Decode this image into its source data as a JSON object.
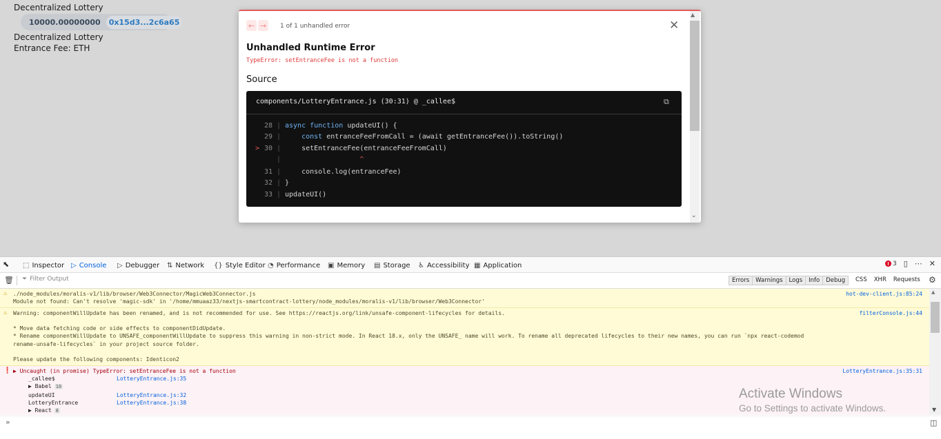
{
  "page": {
    "app_title": "Decentralized Lottery",
    "balance": "10000.00000000",
    "address": "0x15d3...2c6a65",
    "lottery_title": "Decentralized Lottery",
    "entrance_fee": "Entrance Fee: ETH"
  },
  "error_overlay": {
    "prev_arrow": "←",
    "next_arrow": "→",
    "count_text": "1 of 1 unhandled error",
    "close": "✕",
    "heading": "Unhandled Runtime Error",
    "message": "TypeError: setEntranceFee is not a function",
    "source_label": "Source",
    "file_location": "components/LotteryEntrance.js (30:31) @ _callee$",
    "code_lines": [
      {
        "marker": "",
        "num": "28",
        "code": "async function updateUI() {"
      },
      {
        "marker": "",
        "num": "29",
        "code": "    const entranceFeeFromCall = (await getEntranceFee()).toString()"
      },
      {
        "marker": ">",
        "num": "30",
        "code": "    setEntranceFee(entranceFeeFromCall)"
      },
      {
        "marker": "",
        "num": "",
        "code": "                  ^"
      },
      {
        "marker": "",
        "num": "31",
        "code": "    console.log(entranceFee)"
      },
      {
        "marker": "",
        "num": "32",
        "code": "}"
      },
      {
        "marker": "",
        "num": "33",
        "code": "updateUI()"
      }
    ]
  },
  "devtools": {
    "tabs": [
      {
        "name": "inspector",
        "label": "Inspector",
        "icon": "⬚"
      },
      {
        "name": "console",
        "label": "Console",
        "icon": "▷",
        "active": true
      },
      {
        "name": "debugger",
        "label": "Debugger",
        "icon": "▷"
      },
      {
        "name": "network",
        "label": "Network",
        "icon": "⇅"
      },
      {
        "name": "style-editor",
        "label": "Style Editor",
        "icon": "{}"
      },
      {
        "name": "performance",
        "label": "Performance",
        "icon": "◔"
      },
      {
        "name": "memory",
        "label": "Memory",
        "icon": "▣"
      },
      {
        "name": "storage",
        "label": "Storage",
        "icon": "▤"
      },
      {
        "name": "accessibility",
        "label": "Accessibility",
        "icon": "♿"
      },
      {
        "name": "application",
        "label": "Application",
        "icon": "▦"
      }
    ],
    "error_count": "3",
    "filter_placeholder": "Filter Output",
    "levels": [
      "Errors",
      "Warnings",
      "Logs",
      "Info",
      "Debug"
    ],
    "request_filters": [
      "CSS",
      "XHR",
      "Requests"
    ],
    "messages": [
      {
        "type": "warn",
        "source": "hot-dev-client.js:85:24",
        "lines": [
          "./node_modules/moralis-v1/lib/browser/Web3Connector/MagicWeb3Connector.js",
          "Module not found: Can't resolve 'magic-sdk' in '/home/mmuaaz33/nextjs-smartcontract-lottery/node_modules/moralis-v1/lib/browser/Web3Connector'"
        ]
      },
      {
        "type": "warn",
        "source": "filterConsole.js:44",
        "lines": [
          "Warning: componentWillUpdate has been renamed, and is not recommended for use. See https://reactjs.org/link/unsafe-component-lifecycles for details.",
          "",
          "* Move data fetching code or side effects to componentDidUpdate.",
          "* Rename componentWillUpdate to UNSAFE_componentWillUpdate to suppress this warning in non-strict mode. In React 18.x, only the UNSAFE_ name will work. To rename all deprecated lifecycles to their new names, you can run `npx react-codemod",
          "rename-unsafe-lifecycles` in your project source folder.",
          "",
          "Please update the following components: Identicon2"
        ]
      }
    ],
    "error_message": {
      "text": "Uncaught (in promise) TypeError: setEntranceFee is not a function",
      "source": "LotteryEntrance.js:35:31",
      "trace": [
        {
          "fn": "_callee$",
          "loc": "LotteryEntrance.js:35",
          "badge": ""
        },
        {
          "fn": "▶ Babel",
          "loc": "",
          "badge": "10"
        },
        {
          "fn": "updateUI",
          "loc": "LotteryEntrance.js:32",
          "badge": ""
        },
        {
          "fn": "LotteryEntrance",
          "loc": "LotteryEntrance.js:38",
          "badge": ""
        },
        {
          "fn": "▶ React",
          "loc": "",
          "badge": "8"
        }
      ]
    },
    "prompt": "»"
  },
  "watermark": {
    "title": "Activate Windows",
    "subtitle": "Go to Settings to activate Windows."
  }
}
